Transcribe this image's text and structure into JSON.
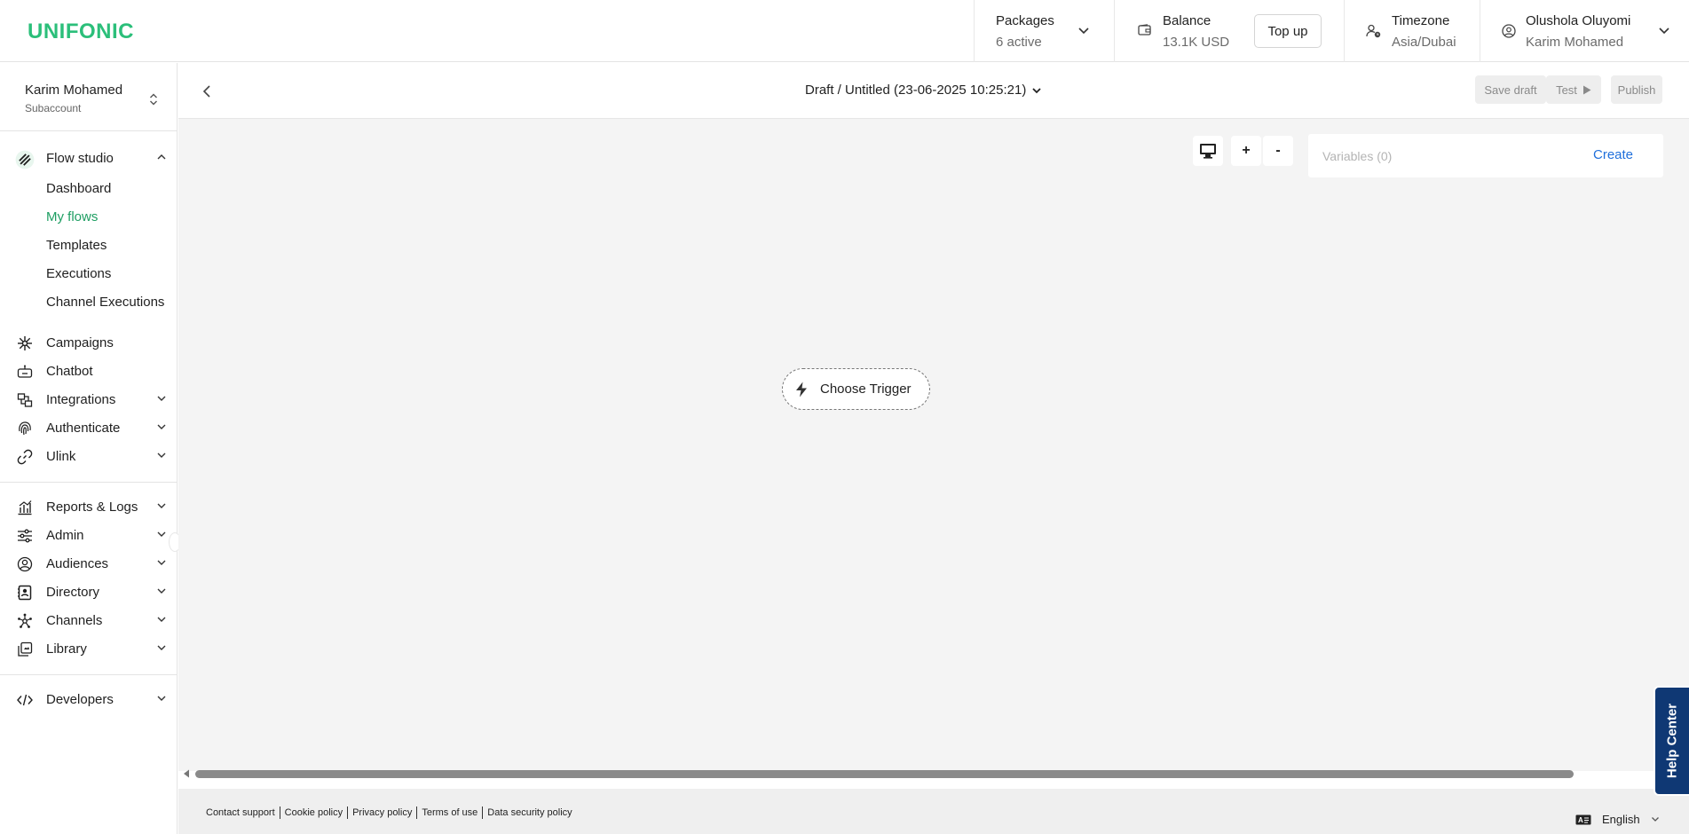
{
  "app": {
    "logo": "UNIFONIC",
    "brand_color": "#2bbf7a",
    "active_color": "#1e9e62",
    "link_color": "#1f6fdb",
    "help_color": "#0f3874"
  },
  "topbar": {
    "packages": {
      "title": "Packages",
      "value": "6 active"
    },
    "balance": {
      "title": "Balance",
      "value": "13.1K USD",
      "icon": "wallet-icon"
    },
    "topup_label": "Top up",
    "timezone": {
      "title": "Timezone",
      "value": "Asia/Dubai",
      "icon": "user-clock-icon"
    },
    "user": {
      "name": "Olushola Oluyomi",
      "account": "Karim Mohamed",
      "icon": "user-circle-icon"
    }
  },
  "sidebar": {
    "account_name": "Karim Mohamed",
    "account_type": "Subaccount",
    "flow_studio": {
      "label": "Flow studio",
      "icon": "flow-studio-icon",
      "expanded": true,
      "items": [
        {
          "label": "Dashboard",
          "active": false
        },
        {
          "label": "My flows",
          "active": true
        },
        {
          "label": "Templates",
          "active": false
        },
        {
          "label": "Executions",
          "active": false
        },
        {
          "label": "Channel Executions",
          "active": false
        }
      ]
    },
    "group1": [
      {
        "label": "Campaigns",
        "icon": "campaigns-icon",
        "has_children": false
      },
      {
        "label": "Chatbot",
        "icon": "chatbot-icon",
        "has_children": false
      },
      {
        "label": "Integrations",
        "icon": "integrations-icon",
        "has_children": true
      },
      {
        "label": "Authenticate",
        "icon": "fingerprint-icon",
        "has_children": true
      },
      {
        "label": "Ulink",
        "icon": "link-icon",
        "has_children": true
      }
    ],
    "group2": [
      {
        "label": "Reports & Logs",
        "icon": "reports-icon",
        "has_children": true
      },
      {
        "label": "Admin",
        "icon": "sliders-icon",
        "has_children": true
      },
      {
        "label": "Audiences",
        "icon": "audiences-icon",
        "has_children": true
      },
      {
        "label": "Directory",
        "icon": "directory-icon",
        "has_children": true
      },
      {
        "label": "Channels",
        "icon": "channels-icon",
        "has_children": true
      },
      {
        "label": "Library",
        "icon": "library-icon",
        "has_children": true
      }
    ],
    "group3": [
      {
        "label": "Developers",
        "icon": "code-icon",
        "has_children": true
      }
    ]
  },
  "editor": {
    "title": "Draft / Untitled (23-06-2025 10:25:21)",
    "save_draft": "Save draft",
    "test": "Test",
    "publish": "Publish"
  },
  "canvas": {
    "zoom_in": "+",
    "zoom_out": "-",
    "variables_label": "Variables (0)",
    "create_label": "Create",
    "trigger_label": "Choose Trigger"
  },
  "footer": {
    "links": [
      "Contact support",
      "Cookie policy",
      "Privacy policy",
      "Terms of use",
      "Data security policy"
    ],
    "language": "English"
  },
  "help_center": "Help Center"
}
